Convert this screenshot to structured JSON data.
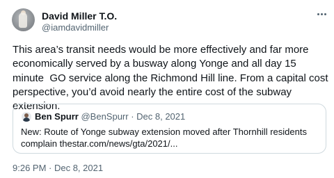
{
  "author": {
    "display_name": "David Miller T.O.",
    "handle": "@iamdavidmiller"
  },
  "more_icon": "more-horizontal-icon",
  "tweet_text": "This area’s transit needs would be more effectively and far more economically served by a busway along Yonge and all day 15 minute  GO service along the Richmond Hill line. From a capital cost perspective, you’d avoid nearly the entire cost of the subway extension.",
  "quoted_tweet": {
    "author_name": "Ben Spurr",
    "meta": "@BenSpurr · Dec 8, 2021",
    "text_line1": "New: Route of Yonge subway extension moved after Thornhill residents",
    "text_line2": "complain thestar.com/news/gta/2021/..."
  },
  "timestamp": "9:26 PM · Dec 8, 2021",
  "colors": {
    "text_primary": "#0f1419",
    "text_secondary": "#536471",
    "border": "#cfd9de"
  }
}
